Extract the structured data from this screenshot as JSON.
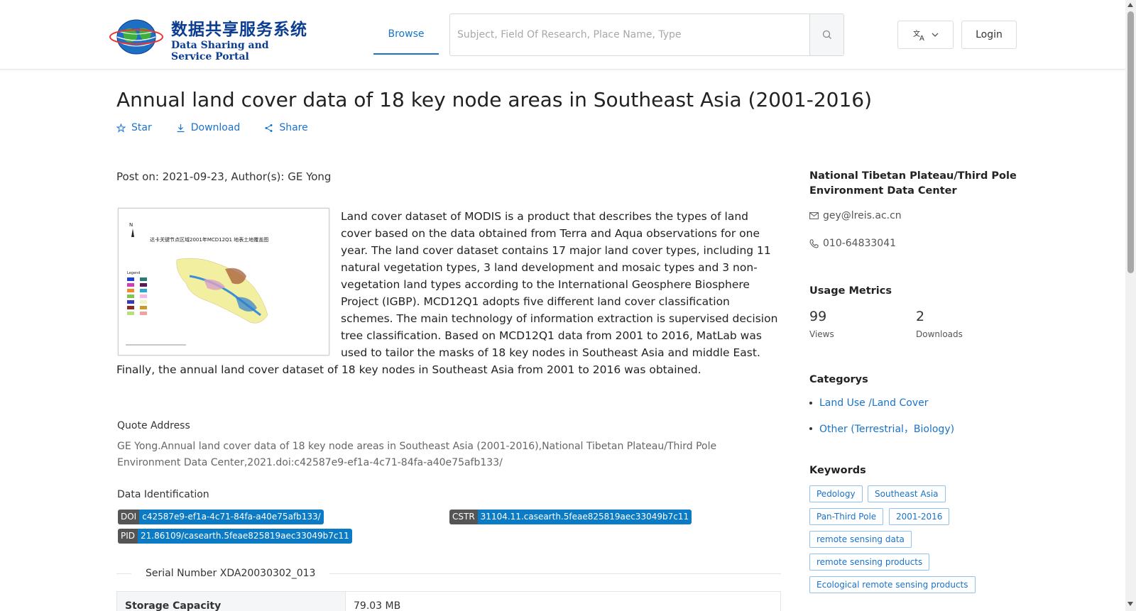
{
  "header": {
    "logo_cn": "数据共享服务系统",
    "logo_en": "Data Sharing and Service Portal",
    "nav_browse": "Browse",
    "search_placeholder": "Subject, Field Of Research, Place Name, Type",
    "login": "Login"
  },
  "dataset": {
    "title": "Annual land cover data of 18 key node areas in Southeast Asia (2001-2016)",
    "actions": {
      "star": "Star",
      "download": "Download",
      "share": "Share"
    },
    "post_meta": "Post on: 2021-09-23, Author(s): GE Yong",
    "thumbnail_caption": "达卡关键节点区域2001年MCD12Q1 地表土地覆盖图",
    "description": "Land cover dataset of MODIS is a product that describes the types of land cover based on the data obtained from Terra and Aqua observations for one year. The land cover dataset contains 17 major land cover types, including 11 natural vegetation types, 3 land development and mosaic types and 3 non-vegetation land types according to the International Geosphere Biosphere Project (IGBP). MCD12Q1 adopts five different land cover classification schemes. The main technology of information extraction is supervised decision tree classification. Based on MCD12Q1 data from 2001 to 2016, MatLab was used to tailor the masks of 18 key nodes in Southeast Asia and middle East. Finally, the annual land cover dataset of 18 key nodes in Southeast Asia from 2001 to 2016 was obtained.",
    "quote_label": "Quote Address",
    "quote_text": "GE Yong.Annual land cover data of 18 key node areas in Southeast Asia (2001-2016),National Tibetan Plateau/Third Pole Environment Data Center,2021.doi:c42587e9-ef1a-4c71-84fa-a40e75afb133/",
    "identification_label": "Data Identification",
    "doi_key": "DOI",
    "doi_value": "c42587e9-ef1a-4c71-84fa-a40e75afb133/",
    "cstr_key": "CSTR",
    "cstr_value": "31104.11.casearth.5feae825819aec33049b7c11",
    "pid_key": "PID",
    "pid_value": "21.86109/casearth.5feae825819aec33049b7c11",
    "serial": "Serial Number XDA20030302_013",
    "storage_label": "Storage Capacity",
    "storage_value": "79.03 MB"
  },
  "sidebar": {
    "center_name": "National Tibetan Plateau/Third Pole Environment Data Center",
    "email": "gey@lreis.ac.cn",
    "phone": "010-64833041",
    "metrics_title": "Usage Metrics",
    "views_count": "99",
    "views_label": "Views",
    "downloads_count": "2",
    "downloads_label": "Downloads",
    "categories_title": "Categorys",
    "categories": [
      "Land Use /Land Cover",
      "Other (Terrestrial，Biology)"
    ],
    "keywords_title": "Keywords",
    "keywords": [
      "Pedology",
      "Southeast Asia",
      "Pan-Third Pole",
      "2001-2016",
      "remote sensing data",
      "remote sensing products",
      "Ecological remote sensing products"
    ]
  },
  "colors": {
    "accent": "#1a73c8",
    "badge_key": "#555555",
    "badge_value": "#0a7bc4"
  }
}
